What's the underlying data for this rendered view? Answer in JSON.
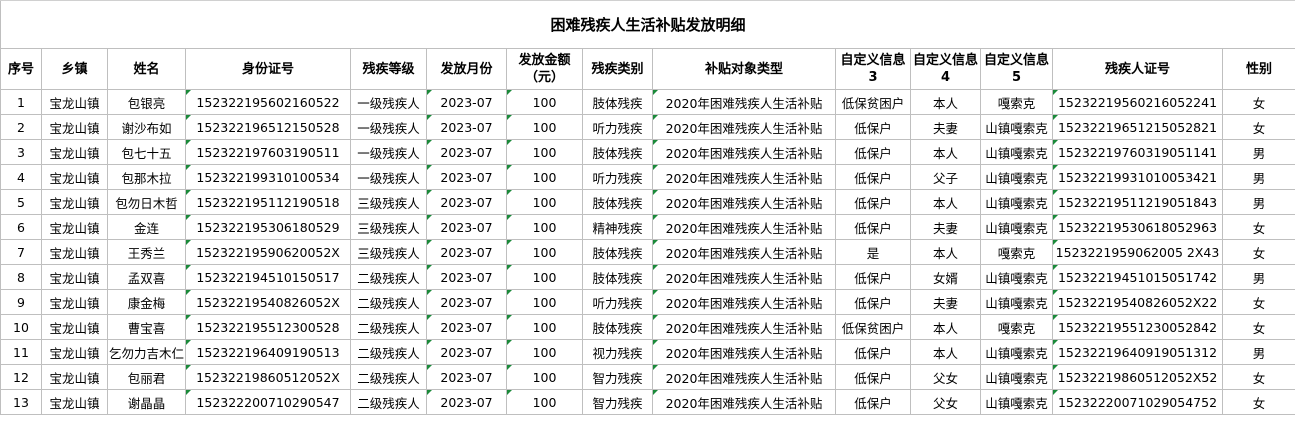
{
  "sheet": {
    "title": "困难残疾人生活补贴发放明细",
    "headers": [
      "序号",
      "乡镇",
      "姓名",
      "身份证号",
      "残疾等级",
      "发放月份",
      "发放金额（元）",
      "残疾类别",
      "补贴对象类型",
      "自定义信息3",
      "自定义信息4",
      "自定义信息5",
      "残疾人证号",
      "性别"
    ],
    "rows": [
      [
        "1",
        "宝龙山镇",
        "包银亮",
        "152322195602160522",
        "一级残疾人",
        "2023-07",
        "100",
        "肢体残疾",
        "2020年困难残疾人生活补贴",
        "低保贫困户",
        "本人",
        "嘎索克",
        "15232219560216052241",
        "女"
      ],
      [
        "2",
        "宝龙山镇",
        "谢沙布如",
        "152322196512150528",
        "一级残疾人",
        "2023-07",
        "100",
        "听力残疾",
        "2020年困难残疾人生活补贴",
        "低保户",
        "夫妻",
        "山镇嘎索克",
        "15232219651215052821",
        "女"
      ],
      [
        "3",
        "宝龙山镇",
        "包七十五",
        "152322197603190511",
        "一级残疾人",
        "2023-07",
        "100",
        "肢体残疾",
        "2020年困难残疾人生活补贴",
        "低保户",
        "本人",
        "山镇嘎索克",
        "15232219760319051141",
        "男"
      ],
      [
        "4",
        "宝龙山镇",
        "包那木拉",
        "152322199310100534",
        "一级残疾人",
        "2023-07",
        "100",
        "听力残疾",
        "2020年困难残疾人生活补贴",
        "低保户",
        "父子",
        "山镇嘎索克",
        "15232219931010053421",
        "男"
      ],
      [
        "5",
        "宝龙山镇",
        "包勿日木哲",
        "152322195112190518",
        "三级残疾人",
        "2023-07",
        "100",
        "肢体残疾",
        "2020年困难残疾人生活补贴",
        "低保户",
        "本人",
        "山镇嘎索克",
        "15232219511219051843",
        "男"
      ],
      [
        "6",
        "宝龙山镇",
        "金连",
        "152322195306180529",
        "三级残疾人",
        "2023-07",
        "100",
        "精神残疾",
        "2020年困难残疾人生活补贴",
        "低保户",
        "夫妻",
        "山镇嘎索克",
        "15232219530618052963",
        "女"
      ],
      [
        "7",
        "宝龙山镇",
        "王秀兰",
        "15232219590620052X",
        "三级残疾人",
        "2023-07",
        "100",
        "肢体残疾",
        "2020年困难残疾人生活补贴",
        "是",
        "本人",
        "嘎索克",
        "1523221959062005 2X43",
        "女"
      ],
      [
        "8",
        "宝龙山镇",
        "孟双喜",
        "152322194510150517",
        "二级残疾人",
        "2023-07",
        "100",
        "肢体残疾",
        "2020年困难残疾人生活补贴",
        "低保户",
        "女婿",
        "山镇嘎索克",
        "15232219451015051742",
        "男"
      ],
      [
        "9",
        "宝龙山镇",
        "康金梅",
        "15232219540826052X",
        "二级残疾人",
        "2023-07",
        "100",
        "听力残疾",
        "2020年困难残疾人生活补贴",
        "低保户",
        "夫妻",
        "山镇嘎索克",
        "15232219540826052X22",
        "女"
      ],
      [
        "10",
        "宝龙山镇",
        "曹宝喜",
        "152322195512300528",
        "二级残疾人",
        "2023-07",
        "100",
        "肢体残疾",
        "2020年困难残疾人生活补贴",
        "低保贫困户",
        "本人",
        "嘎索克",
        "15232219551230052842",
        "女"
      ],
      [
        "11",
        "宝龙山镇",
        "乞勿力吉木仁",
        "152322196409190513",
        "二级残疾人",
        "2023-07",
        "100",
        "视力残疾",
        "2020年困难残疾人生活补贴",
        "低保户",
        "本人",
        "山镇嘎索克",
        "15232219640919051312",
        "男"
      ],
      [
        "12",
        "宝龙山镇",
        "包丽君",
        "15232219860512052X",
        "二级残疾人",
        "2023-07",
        "100",
        "智力残疾",
        "2020年困难残疾人生活补贴",
        "低保户",
        "父女",
        "山镇嘎索克",
        "15232219860512052X52",
        "女"
      ],
      [
        "13",
        "宝龙山镇",
        "谢晶晶",
        "152322200710290547",
        "二级残疾人",
        "2023-07",
        "100",
        "智力残疾",
        "2020年困难残疾人生活补贴",
        "低保户",
        "父女",
        "山镇嘎索克",
        "15232220071029054752",
        "女"
      ]
    ]
  }
}
